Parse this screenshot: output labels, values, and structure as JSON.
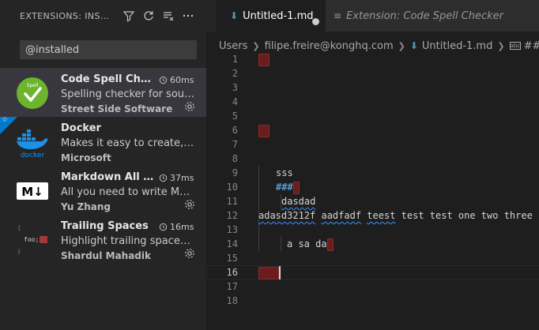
{
  "sidebar": {
    "title": "EXTENSIONS: INSTA...",
    "actions": [
      "filter-icon",
      "refresh-icon",
      "clear-all-icon",
      "more-icon"
    ],
    "search": {
      "value": "@installed",
      "placeholder": ""
    },
    "extensions": [
      {
        "name": "Code Spell Che...",
        "time": "60ms",
        "description": "Spelling checker for sourc...",
        "publisher": "Street Side Software",
        "icon": "spell-check-icon",
        "icon_text": "Spell",
        "selected": true
      },
      {
        "name": "Docker",
        "time": "",
        "description": "Makes it easy to create, m...",
        "publisher": "Microsoft",
        "icon": "docker-icon",
        "icon_text": "docker",
        "recommended": true
      },
      {
        "name": "Markdown All i...",
        "time": "37ms",
        "description": "All you need to write Mark...",
        "publisher": "Yu Zhang",
        "icon": "markdown-icon",
        "icon_text": "M↓"
      },
      {
        "name": "Trailing Spaces",
        "time": "16ms",
        "description": "Highlight trailing spaces a...",
        "publisher": "Shardul Mahadik",
        "icon": "trailing-spaces-icon",
        "icon_text": "foo;"
      }
    ]
  },
  "editor": {
    "tabs": [
      {
        "label": "Untitled-1.md",
        "active": true,
        "dirty": true
      },
      {
        "label": "Extension: Code Spell Checker",
        "active": false
      }
    ],
    "breadcrumb": [
      "Users",
      "filipe.freire@konghq.com",
      "Untitled-1.md",
      "###"
    ],
    "current_line": "16",
    "lines": [
      {
        "n": "1"
      },
      {
        "n": "2"
      },
      {
        "n": "3"
      },
      {
        "n": "4"
      },
      {
        "n": "5"
      },
      {
        "n": "6"
      },
      {
        "n": "7"
      },
      {
        "n": "8"
      },
      {
        "n": "9",
        "text": "sss"
      },
      {
        "n": "10",
        "text": "###"
      },
      {
        "n": "11",
        "text": "dasdad"
      },
      {
        "n": "12",
        "text": "adasd3212f aadfadf teest test test one two three"
      },
      {
        "n": "13"
      },
      {
        "n": "14",
        "text": "a sa da"
      },
      {
        "n": "15"
      },
      {
        "n": "16"
      },
      {
        "n": "17"
      },
      {
        "n": "18"
      }
    ],
    "words": {
      "l12a": "adasd3212f",
      "l12b": "aadfadf",
      "l12c": "teest",
      "l12d": "test test one two three"
    }
  },
  "colors": {
    "accent": "#007acc",
    "trailing_space": "#6b1d1d",
    "squiggle": "#3794ff"
  }
}
